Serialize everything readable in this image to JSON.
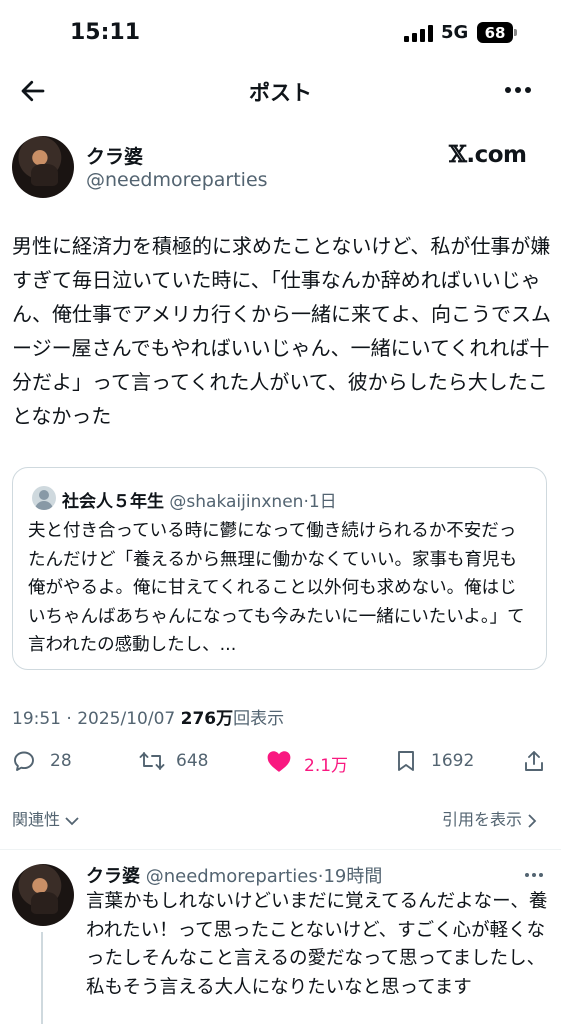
{
  "status_bar": {
    "time": "15:11",
    "network": "5G",
    "battery": "68"
  },
  "header": {
    "title": "ポスト"
  },
  "post": {
    "author_name": "クラ婆",
    "author_handle": "@needmoreparties",
    "source_label": ".com",
    "source_x": "𝕏",
    "text": "男性に経済力を積極的に求めたことないけど、私が仕事が嫌すぎて毎日泣いていた時に、「仕事なんか辞めればいいじゃん、俺仕事でアメリカ行くから一緒に来てよ、向こうでスムージー屋さんでもやればいいじゃん、一緒にいてくれれば十分だよ」って言ってくれた人がいて、彼からしたら大したことなかった",
    "quote": {
      "name": "社会人５年生",
      "handle": "@shakaijinxnen",
      "dot": "·",
      "age": "1日",
      "text": "夫と付き合っている時に鬱になって働き続けられるか不安だったんだけど「養えるから無理に働かなくていい。家事も育児も俺がやるよ。俺に甘えてくれること以外何も求めない。俺はじいちゃんばあちゃんになっても今みたいに一緒にいたいよ。」て言われたの感動したし、..."
    },
    "time": "19:51",
    "sep": " · ",
    "date": "2025/10/07",
    "views_count": "276万",
    "views_label": "回表示",
    "stats": {
      "replies": "28",
      "reposts": "648",
      "likes": "2.1万",
      "bookmarks": "1692"
    },
    "liked": true
  },
  "sort": {
    "label": "関連性",
    "quotes_link": "引用を表示"
  },
  "reply": {
    "author_name": "クラ婆",
    "author_handle": "@needmoreparties",
    "dot": "·",
    "age": "19時間",
    "text": "言葉かもしれないけどいまだに覚えてるんだよなー、養われたい！って思ったことないけど、すごく心が軽くなったしそんなこと言えるの愛だなって思ってましたし、私もそう言える大人になりたいなと思ってます"
  },
  "colors": {
    "accent_like": "#f91880",
    "text": "#0f1419",
    "muted": "#536471",
    "border": "#cfd9de"
  }
}
